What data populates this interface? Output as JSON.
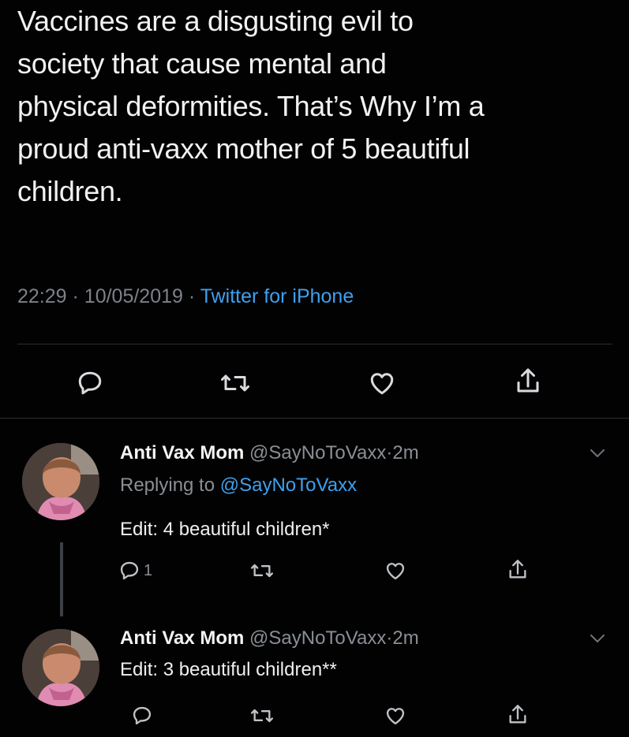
{
  "tweet": {
    "lines": [
      "Vaccines are a disgusting evil to",
      "society that cause mental and",
      "physical deformities. That’s Why I’m a",
      "proud anti-vaxx mother of 5 beautiful",
      "children."
    ],
    "time": "22:29",
    "date": "10/05/2019",
    "separator": "·",
    "source": "Twitter for iPhone"
  },
  "replies": [
    {
      "name": "Anti Vax Mom",
      "handle": "@SayNoToVaxx",
      "age": "2m",
      "replying_prefix": "Replying to",
      "replying_handle": "@SayNoToVaxx",
      "text": "Edit: 4 beautiful children*",
      "reply_count": "1"
    },
    {
      "name": "Anti Vax Mom",
      "handle": "@SayNoToVaxx",
      "age": "2m",
      "text": "Edit: 3 beautiful children**"
    }
  ],
  "colors": {
    "background": "#020203",
    "link": "#3fa0ee",
    "muted": "#8a8f95"
  },
  "icons": [
    "reply-icon",
    "retweet-icon",
    "like-icon",
    "share-icon",
    "caret-down-icon"
  ]
}
